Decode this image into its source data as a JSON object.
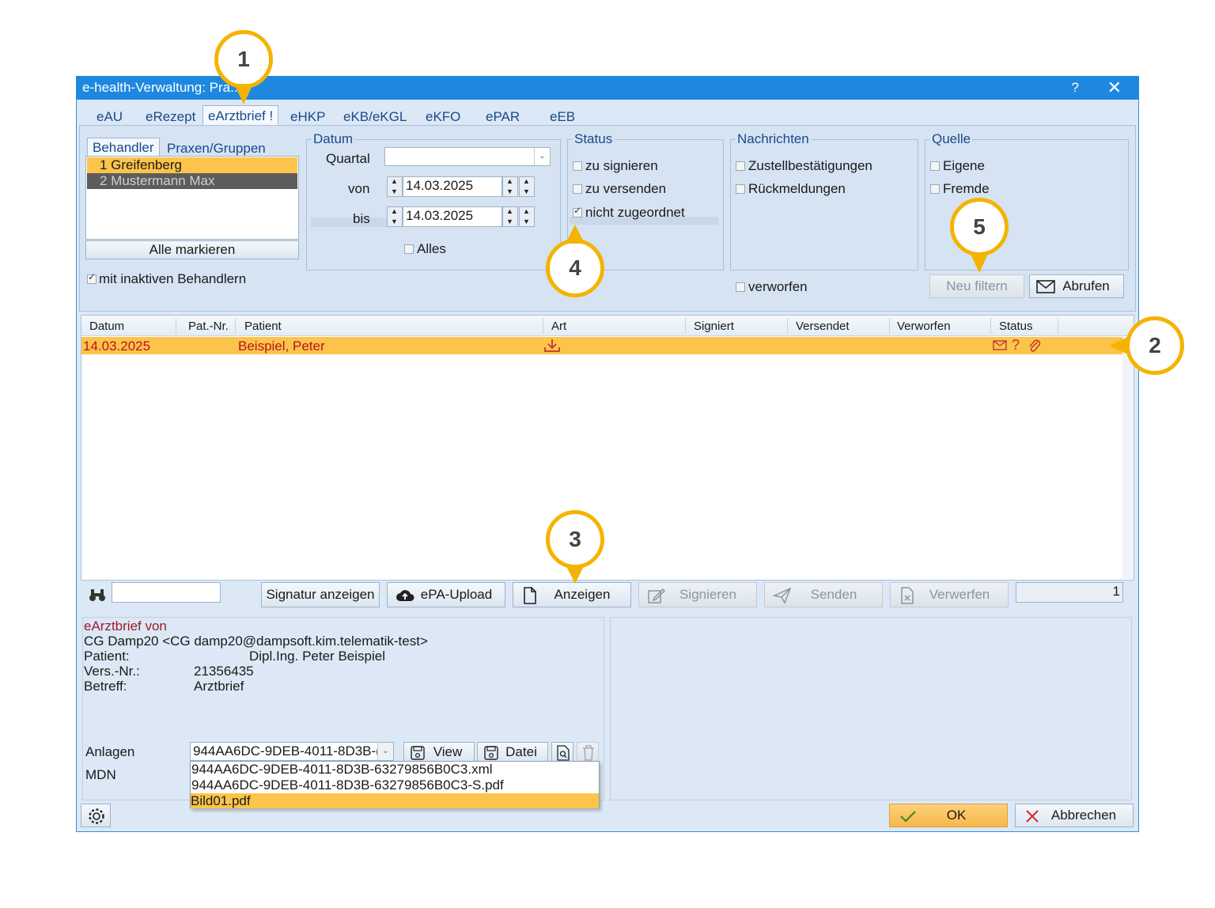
{
  "window": {
    "title": "e-health-Verwaltung: Pra...",
    "help": "?",
    "close": "✕"
  },
  "tabs": [
    "eAU",
    "eRezept",
    "eArztbrief !",
    "eHKP",
    "eKB/eKGL",
    "eKFO",
    "ePAR",
    "eEB"
  ],
  "behandler": {
    "tab_behandler": "Behandler",
    "tab_praxen": "Praxen/Gruppen",
    "items": [
      "1 Greifenberg",
      "2 Mustermann Max"
    ],
    "select_all": "Alle markieren",
    "inactive_label": "mit inaktiven Behandlern"
  },
  "datum": {
    "title": "Datum",
    "quartal_label": "Quartal",
    "quartal_value": "",
    "von_label": "von",
    "von_value": "14.03.2025",
    "bis_label": "bis",
    "bis_value": "14.03.2025",
    "alles_label": "Alles"
  },
  "status": {
    "title": "Status",
    "zu_signieren": "zu signieren",
    "zu_versenden": "zu versenden",
    "nicht_zugeordnet": "nicht zugeordnet"
  },
  "nachrichten": {
    "title": "Nachrichten",
    "zustell": "Zustellbestätigungen",
    "rueck": "Rückmeldungen",
    "verworfen": "verworfen"
  },
  "quelle": {
    "title": "Quelle",
    "eigene": "Eigene",
    "fremde": "Fremde"
  },
  "filter_buttons": {
    "neu_filtern": "Neu filtern",
    "abrufen": "Abrufen"
  },
  "table": {
    "columns": [
      "Datum",
      "Pat.-Nr.",
      "Patient",
      "Art",
      "Signiert",
      "Versendet",
      "Verworfen",
      "Status"
    ],
    "rows": [
      {
        "datum": "14.03.2025",
        "patnr": "",
        "patient": "Beispiel, Peter",
        "status_help": "?"
      }
    ]
  },
  "toolbar": {
    "search_value": "",
    "signatur": "Signatur anzeigen",
    "epa": "ePA-Upload",
    "anzeigen": "Anzeigen",
    "signieren": "Signieren",
    "senden": "Senden",
    "verwerfen": "Verwerfen",
    "count": "1"
  },
  "detail": {
    "heading": "eArztbrief von",
    "from": "CG Damp20 <CG damp20@dampsoft.kim.telematik-test>",
    "patient_label": "Patient:",
    "patient_value": "Dipl.Ing. Peter Beispiel",
    "vers_label": "Vers.-Nr.:",
    "vers_value": "21356435",
    "betreff_label": "Betreff:",
    "betreff_value": "Arztbrief",
    "anlagen_label": "Anlagen",
    "anlagen_value": "944AA6DC-9DEB-4011-8D3B-(",
    "view": "View",
    "datei": "Datei",
    "mdn_label": "MDN",
    "dropdown": [
      "944AA6DC-9DEB-4011-8D3B-63279856B0C3.xml",
      "944AA6DC-9DEB-4011-8D3B-63279856B0C3-S.pdf",
      "Bild01.pdf"
    ]
  },
  "footer": {
    "ok": "OK",
    "abbrechen": "Abbrechen"
  },
  "callouts": [
    "1",
    "2",
    "3",
    "4",
    "5"
  ],
  "colors": {
    "accent": "#f5b301",
    "titlebar": "#1e88e0",
    "selected_row": "#fcc44a"
  }
}
